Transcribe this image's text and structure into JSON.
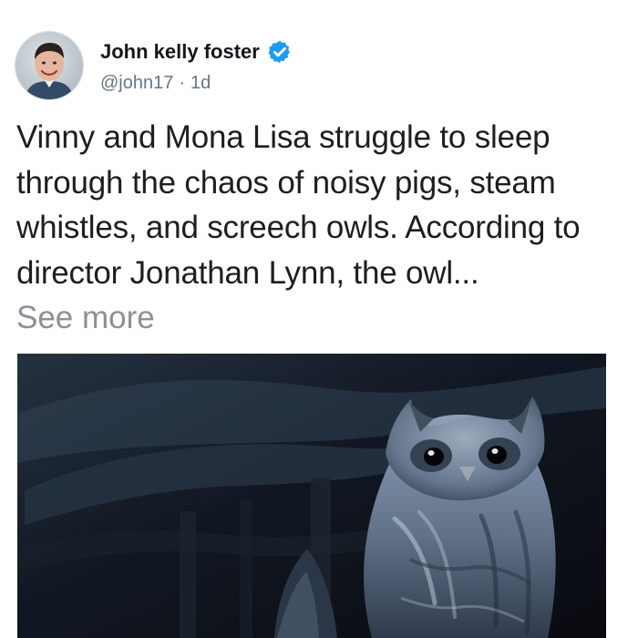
{
  "post": {
    "author": {
      "name": "John kelly foster",
      "handle": "@john17",
      "separator": "·",
      "time": "1d",
      "verified": true,
      "avatar_icon": "profile-photo",
      "verified_icon": "verified-badge-icon"
    },
    "text": "Vinny and Mona Lisa struggle to sleep through the chaos of noisy pigs, steam whistles, and screech owls. According to director Jonathan Lynn, the owl...",
    "see_more_label": "See more",
    "media": {
      "type": "image",
      "subject": "screech owl at night"
    }
  },
  "colors": {
    "text_primary": "#14171a",
    "text_secondary": "#657786",
    "see_more": "#8b9198",
    "verified_blue": "#1d9bf0"
  }
}
